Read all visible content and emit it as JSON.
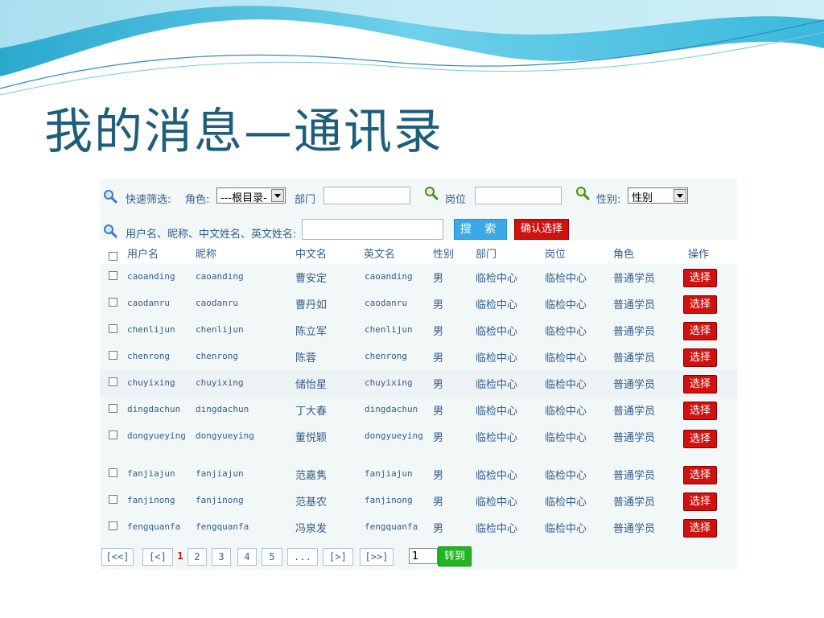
{
  "slide": {
    "title": "我的消息—通讯录"
  },
  "filter": {
    "quick_filter_label": "快速筛选:",
    "role_label": "角色:",
    "role_selected": "---根目录-",
    "department_label": "部门",
    "department_value": "",
    "position_label": "岗位",
    "position_value": "",
    "gender_label": "性别:",
    "gender_selected": "性别",
    "name_search_label": "用户名、昵称、中文姓名、英文姓名:",
    "name_search_value": "",
    "search_button": "搜 索",
    "confirm_button": "确认选择"
  },
  "table": {
    "headers": [
      "用户名",
      "昵称",
      "中文名",
      "英文名",
      "性别",
      "部门",
      "岗位",
      "角色",
      "操作"
    ],
    "select_label": "选择",
    "rows": [
      {
        "username": "caoanding",
        "nickname": "caoanding",
        "cn_name": "曹安定",
        "en_name": "caoanding",
        "gender": "男",
        "department": "临检中心",
        "position": "临检中心",
        "role": "普通学员"
      },
      {
        "username": "caodanru",
        "nickname": "caodanru",
        "cn_name": "曹丹如",
        "en_name": "caodanru",
        "gender": "男",
        "department": "临检中心",
        "position": "临检中心",
        "role": "普通学员"
      },
      {
        "username": "chenlijun",
        "nickname": "chenlijun",
        "cn_name": "陈立军",
        "en_name": "chenlijun",
        "gender": "男",
        "department": "临检中心",
        "position": "临检中心",
        "role": "普通学员"
      },
      {
        "username": "chenrong",
        "nickname": "chenrong",
        "cn_name": "陈蓉",
        "en_name": "chenrong",
        "gender": "男",
        "department": "临检中心",
        "position": "临检中心",
        "role": "普通学员"
      },
      {
        "username": "chuyixing",
        "nickname": "chuyixing",
        "cn_name": "储怡星",
        "en_name": "chuyixing",
        "gender": "男",
        "department": "临检中心",
        "position": "临检中心",
        "role": "普通学员"
      },
      {
        "username": "dingdachun",
        "nickname": "dingdachun",
        "cn_name": "丁大春",
        "en_name": "dingdachun",
        "gender": "男",
        "department": "临检中心",
        "position": "临检中心",
        "role": "普通学员"
      },
      {
        "username": "dongyueying",
        "nickname": "dongyueying",
        "cn_name": "董悦颖",
        "en_name": "dongyueying",
        "gender": "男",
        "department": "临检中心",
        "position": "临检中心",
        "role": "普通学员"
      },
      {
        "username": "fanjiajun",
        "nickname": "fanjiajun",
        "cn_name": "范嘉隽",
        "en_name": "fanjiajun",
        "gender": "男",
        "department": "临检中心",
        "position": "临检中心",
        "role": "普通学员"
      },
      {
        "username": "fanjinong",
        "nickname": "fanjinong",
        "cn_name": "范基农",
        "en_name": "fanjinong",
        "gender": "男",
        "department": "临检中心",
        "position": "临检中心",
        "role": "普通学员"
      },
      {
        "username": "fengquanfa",
        "nickname": "fengquanfa",
        "cn_name": "冯泉发",
        "en_name": "fengquanfa",
        "gender": "男",
        "department": "临检中心",
        "position": "临检中心",
        "role": "普通学员"
      }
    ]
  },
  "pager": {
    "first": "[<<]",
    "prev": "[<]",
    "pages": [
      "1",
      "2",
      "3",
      "4",
      "5",
      "..."
    ],
    "current_page": "1",
    "next": "[>]",
    "last": "[>>]",
    "goto_value": "1",
    "goto_button": "转到"
  },
  "colors": {
    "title": "#1e5e7a",
    "link_text": "#335e8e",
    "select_button": "#d11010",
    "search_button": "#3ba9e8",
    "goto_button": "#22b522",
    "panel_bg": "#f2f7f7"
  }
}
